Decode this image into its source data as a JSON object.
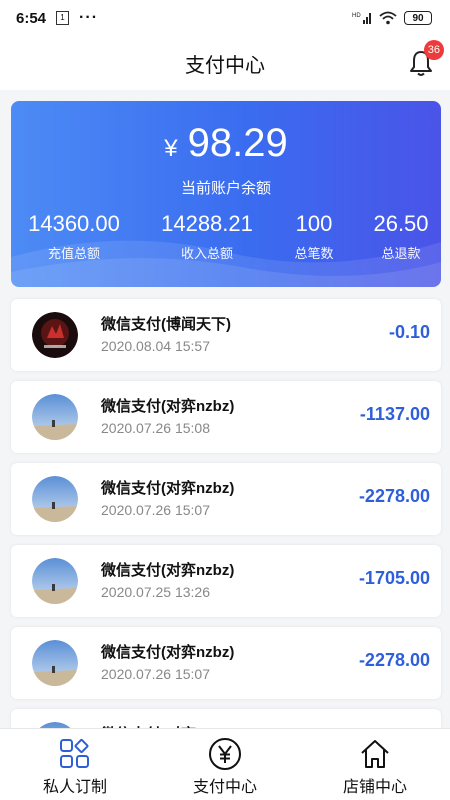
{
  "status_bar": {
    "time": "6:54",
    "sim": "1",
    "dots": "···",
    "network": "HD",
    "battery": "90"
  },
  "header": {
    "title": "支付中心",
    "badge_count": "36"
  },
  "balance": {
    "currency": "¥",
    "amount": "98.29",
    "label": "当前账户余额",
    "stats": [
      {
        "value": "14360.00",
        "label": "充值总额"
      },
      {
        "value": "14288.21",
        "label": "收入总额"
      },
      {
        "value": "100",
        "label": "总笔数"
      },
      {
        "value": "26.50",
        "label": "总退款"
      }
    ]
  },
  "transactions": [
    {
      "title": "微信支付(博闻天下)",
      "time": "2020.08.04 15:57",
      "amount": "-0.10",
      "avatar": "dark-logo-avatar"
    },
    {
      "title": "微信支付(对弈nzbz)",
      "time": "2020.07.26 15:08",
      "amount": "-1137.00",
      "avatar": "sky-photo-avatar"
    },
    {
      "title": "微信支付(对弈nzbz)",
      "time": "2020.07.26 15:07",
      "amount": "-2278.00",
      "avatar": "sky-photo-avatar"
    },
    {
      "title": "微信支付(对弈nzbz)",
      "time": "2020.07.25 13:26",
      "amount": "-1705.00",
      "avatar": "sky-photo-avatar"
    },
    {
      "title": "微信支付(对弈nzbz)",
      "time": "2020.07.26 15:07",
      "amount": "-2278.00",
      "avatar": "sky-photo-avatar"
    },
    {
      "title": "微信支付(对弈nzbz)",
      "time": "",
      "amount": "",
      "avatar": "sky-photo-avatar"
    }
  ],
  "bottom_nav": [
    {
      "label": "私人订制",
      "icon": "grid-icon"
    },
    {
      "label": "支付中心",
      "icon": "yen-circle-icon"
    },
    {
      "label": "店铺中心",
      "icon": "house-icon"
    }
  ],
  "colors": {
    "card_start": "#4d8bf5",
    "card_end": "#4a54e8",
    "amount": "#2f5fd8",
    "badge": "#ee3a3a"
  }
}
